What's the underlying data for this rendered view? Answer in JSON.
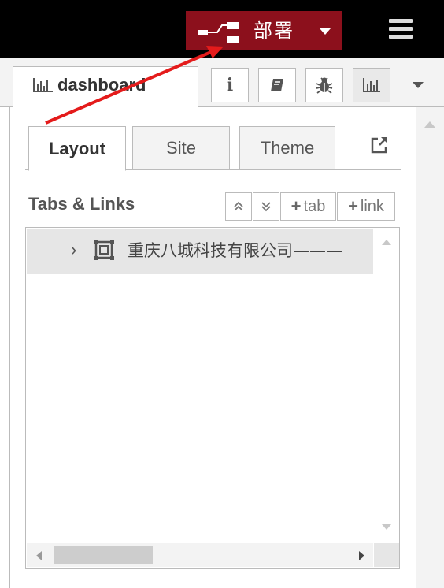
{
  "header": {
    "deploy_label": "部署",
    "deploy_icon": "deploy-flow-icon",
    "menu_icon": "hamburger-menu-icon",
    "deploy_color": "#8c101c",
    "header_bg": "#000000"
  },
  "sidebar": {
    "active_tab_label": "dashboard",
    "active_tab_icon": "bar-chart-icon",
    "tools": [
      {
        "icon": "info-icon"
      },
      {
        "icon": "book-icon"
      },
      {
        "icon": "bug-icon"
      },
      {
        "icon": "bar-chart-icon"
      }
    ],
    "more_icon": "caret-down-icon"
  },
  "dashboard": {
    "subtabs": [
      "Layout",
      "Site",
      "Theme"
    ],
    "active_subtab": "Layout",
    "external_link_icon": "external-link-icon",
    "section_title": "Tabs & Links",
    "buttons": {
      "expand_icon": "double-chevron-up-icon",
      "collapse_icon": "double-chevron-down-icon",
      "add_tab": "tab",
      "add_link": "link"
    },
    "tree": [
      {
        "label": "重庆八城科技有限公司———",
        "icon": "tab-frame-icon",
        "expanded": false
      }
    ]
  },
  "annotation": {
    "type": "arrow",
    "color": "#e41b1b"
  }
}
